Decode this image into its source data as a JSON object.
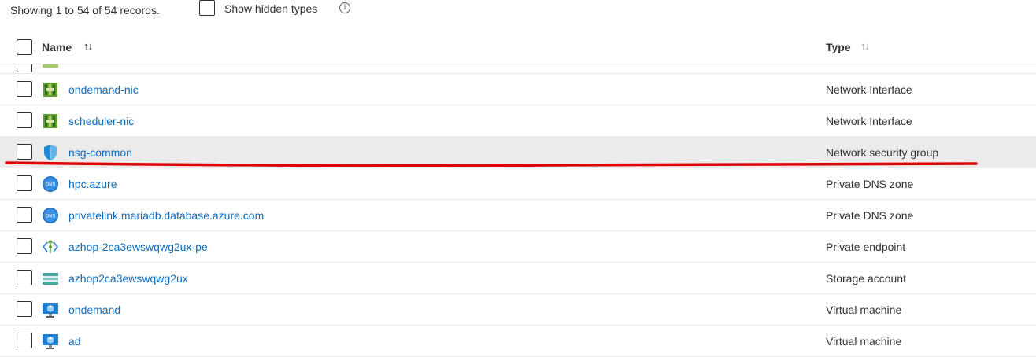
{
  "toolbar": {
    "records_text": "Showing 1 to 54 of 54 records.",
    "show_hidden_label": "Show hidden types",
    "info_glyph": "i"
  },
  "table": {
    "columns": [
      {
        "label": "Name",
        "sort_glyph": "↑↓"
      },
      {
        "label": "Type",
        "sort_glyph": "↑↓"
      }
    ],
    "rows": [
      {
        "name": "ondemand-nic",
        "type": "Network Interface",
        "icon": "network-interface-icon"
      },
      {
        "name": "scheduler-nic",
        "type": "Network Interface",
        "icon": "network-interface-icon"
      },
      {
        "name": "nsg-common",
        "type": "Network security group",
        "icon": "nsg-shield-icon",
        "selected": true
      },
      {
        "name": "hpc.azure",
        "type": "Private DNS zone",
        "icon": "dns-icon"
      },
      {
        "name": "privatelink.mariadb.database.azure.com",
        "type": "Private DNS zone",
        "icon": "dns-icon"
      },
      {
        "name": "azhop-2ca3ewswqwg2ux-pe",
        "type": "Private endpoint",
        "icon": "private-endpoint-icon"
      },
      {
        "name": "azhop2ca3ewswqwg2ux",
        "type": "Storage account",
        "icon": "storage-account-icon"
      },
      {
        "name": "ondemand",
        "type": "Virtual machine",
        "icon": "virtual-machine-icon"
      },
      {
        "name": "ad",
        "type": "Virtual machine",
        "icon": "virtual-machine-icon"
      }
    ],
    "dns_badge": "DNS"
  },
  "colors": {
    "link": "#0f6cbd",
    "text": "#323130",
    "selected_row": "#ebebeb",
    "annotation_underline": "#e00000"
  }
}
